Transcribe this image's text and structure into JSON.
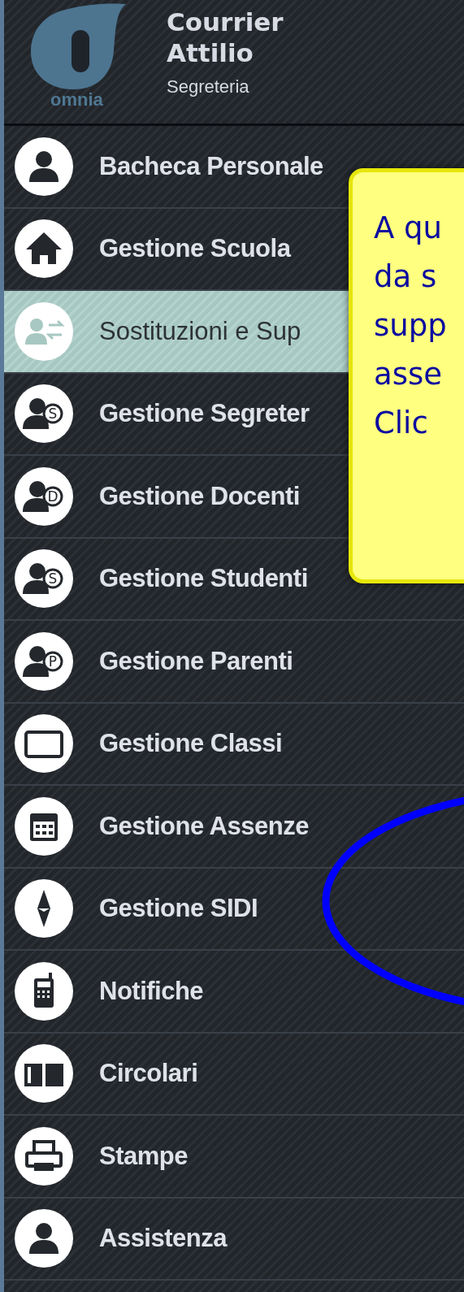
{
  "header": {
    "logo_text": "omnia",
    "user_name": [
      "Courrier",
      "Attilio"
    ],
    "role": "Segreteria"
  },
  "menu": [
    {
      "label": "Bacheca Personale",
      "selected": false
    },
    {
      "label": "Gestione Scuola",
      "selected": false
    },
    {
      "label": "Sostituzioni e Sup",
      "selected": true
    },
    {
      "label": "Gestione Segreter",
      "selected": false,
      "badge": "S"
    },
    {
      "label": "Gestione Docenti",
      "selected": false,
      "badge": "D"
    },
    {
      "label": "Gestione Studenti",
      "selected": false,
      "badge": "S"
    },
    {
      "label": "Gestione Parenti",
      "selected": false,
      "badge": "P"
    },
    {
      "label": "Gestione Classi",
      "selected": false
    },
    {
      "label": "Gestione Assenze",
      "selected": false
    },
    {
      "label": "Gestione SIDI",
      "selected": false
    },
    {
      "label": "Notifiche",
      "selected": false
    },
    {
      "label": "Circolari",
      "selected": false
    },
    {
      "label": "Stampe",
      "selected": false
    },
    {
      "label": "Assistenza",
      "selected": false
    }
  ],
  "callout": {
    "lines": [
      "A qu",
      "da s",
      "supp",
      "asse",
      "Clic"
    ]
  }
}
